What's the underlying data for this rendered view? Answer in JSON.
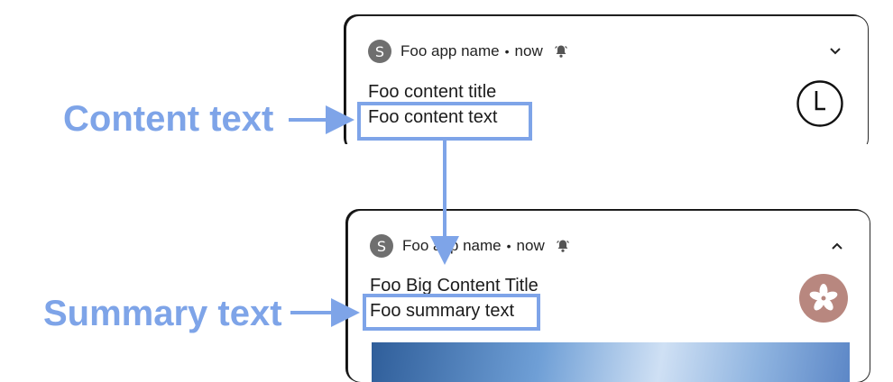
{
  "labels": {
    "content": "Content text",
    "summary": "Summary text"
  },
  "notification_collapsed": {
    "app_icon_letter": "S",
    "app_name": "Foo app name",
    "separator": "•",
    "time": "now",
    "title": "Foo content title",
    "text": "Foo content text",
    "large_icon": "clock-icon",
    "toggle_icon": "chevron-down-icon"
  },
  "notification_expanded": {
    "app_icon_letter": "S",
    "app_name": "Foo app name",
    "separator": "•",
    "time": "now",
    "title": "Foo Big Content Title",
    "summary": "Foo summary text",
    "large_icon": "flower-icon",
    "toggle_icon": "chevron-up-icon"
  },
  "colors": {
    "annotation": "#7ea4e8",
    "large_icon_bg": "#b8877f",
    "app_icon_bg": "#6f6f6f"
  }
}
